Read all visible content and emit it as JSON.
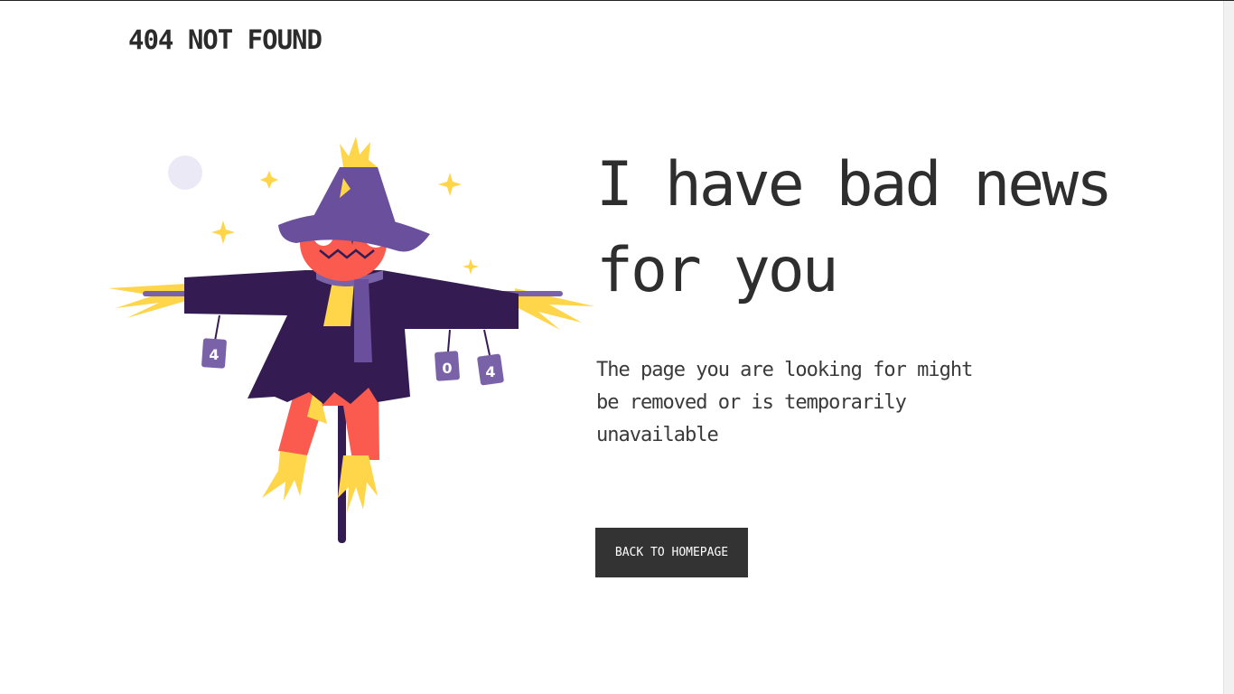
{
  "header": {
    "brand": "404 NOT FOUND"
  },
  "main": {
    "headline": "I have bad news for you",
    "description": "The page you are looking for might be removed or is temporarily unavailable",
    "cta_label": "BACK TO HOMEPAGE"
  },
  "illustration": {
    "can_labels": [
      "4",
      "0",
      "4"
    ]
  },
  "colors": {
    "text": "#333333",
    "button_bg": "#333333",
    "button_text": "#ffffff",
    "hat_purple": "#6a4f9c",
    "coat_dark": "#341c52",
    "face_red": "#fb5a4f",
    "straw_yellow": "#ffd54a",
    "moon": "#ebe9f6"
  }
}
